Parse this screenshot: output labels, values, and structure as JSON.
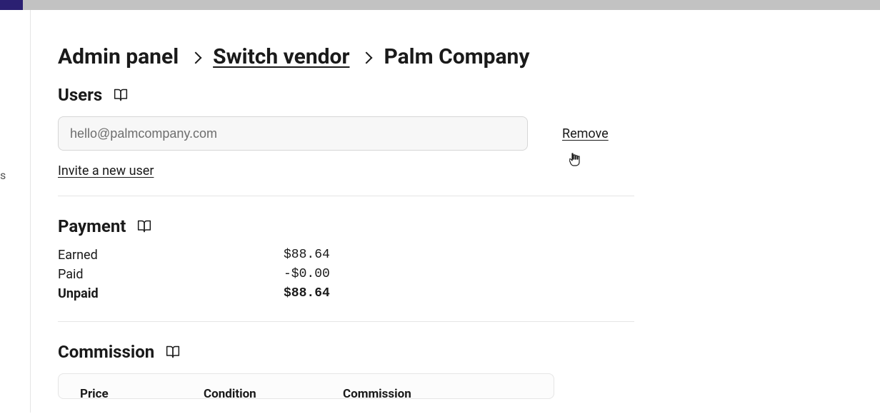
{
  "breadcrumbs": {
    "admin": "Admin panel",
    "switch_vendor": "Switch vendor",
    "company": "Palm Company"
  },
  "users": {
    "title": "Users",
    "email": "hello@palmcompany.com",
    "remove": "Remove",
    "invite": "Invite a new user"
  },
  "payment": {
    "title": "Payment",
    "rows": {
      "earned_label": "Earned",
      "earned_value": "$88.64",
      "paid_label": "Paid",
      "paid_value": "-$0.00",
      "unpaid_label": "Unpaid",
      "unpaid_value": "$88.64"
    }
  },
  "commission": {
    "title": "Commission",
    "headers": {
      "price": "Price",
      "condition": "Condition",
      "commission": "Commission"
    }
  },
  "side_hint": "s"
}
